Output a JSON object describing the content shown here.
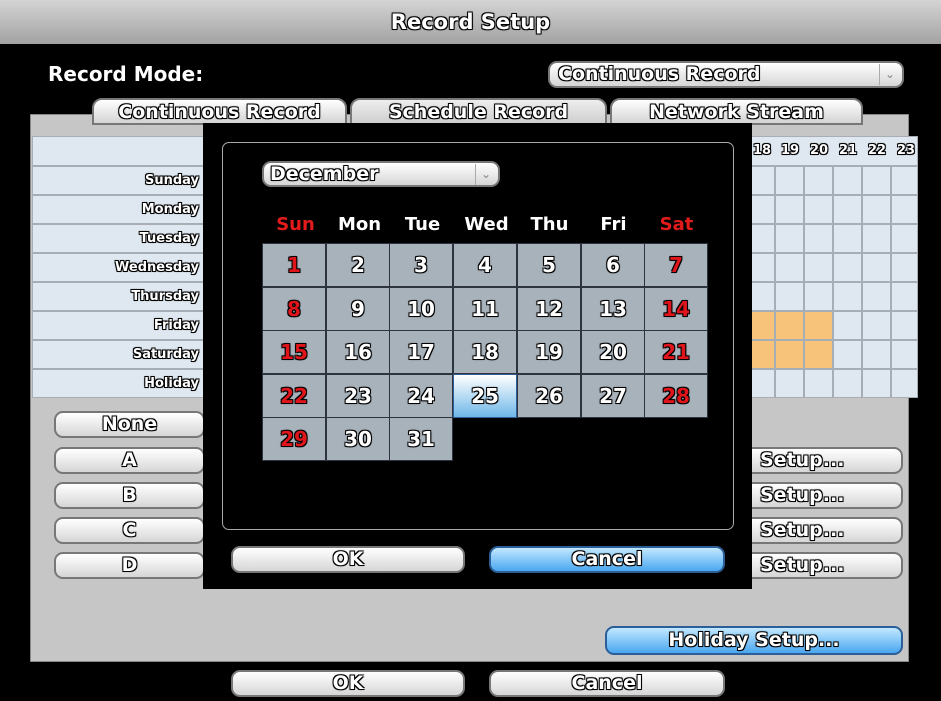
{
  "window": {
    "title": "Record Setup"
  },
  "record_mode": {
    "label": "Record Mode:",
    "value": "Continuous Record"
  },
  "tabs": [
    {
      "label": "Continuous Record"
    },
    {
      "label": "Schedule Record"
    },
    {
      "label": "Network Stream"
    }
  ],
  "schedule": {
    "days": [
      "Sunday",
      "Monday",
      "Tuesday",
      "Wednesday",
      "Thursday",
      "Friday",
      "Saturday",
      "Holiday"
    ],
    "hours_visible": [
      "18",
      "19",
      "20",
      "21",
      "22",
      "23"
    ],
    "highlight_color": "#f7c27a",
    "highlighted": [
      {
        "day": "Friday",
        "hours": [
          "18",
          "19",
          "20"
        ]
      },
      {
        "day": "Saturday",
        "hours": [
          "18",
          "19",
          "20"
        ]
      }
    ]
  },
  "record_types": [
    "None",
    "A",
    "B",
    "C",
    "D"
  ],
  "setup_buttons": [
    "Setup...",
    "Setup...",
    "Setup...",
    "Setup..."
  ],
  "holiday_setup": {
    "label": "Holiday Setup..."
  },
  "footer": {
    "ok_label": "OK",
    "cancel_label": "Cancel"
  },
  "calendar_dialog": {
    "month": "December",
    "weekdays": [
      "Sun",
      "Mon",
      "Tue",
      "Wed",
      "Thu",
      "Fri",
      "Sat"
    ],
    "weekend_color": "#e31b1b",
    "dates": [
      "1",
      "2",
      "3",
      "4",
      "5",
      "6",
      "7",
      "8",
      "9",
      "10",
      "11",
      "12",
      "13",
      "14",
      "15",
      "16",
      "17",
      "18",
      "19",
      "20",
      "21",
      "22",
      "23",
      "24",
      "25",
      "26",
      "27",
      "28",
      "29",
      "30",
      "31"
    ],
    "selected_date": "25",
    "ok_label": "OK",
    "cancel_label": "Cancel"
  }
}
